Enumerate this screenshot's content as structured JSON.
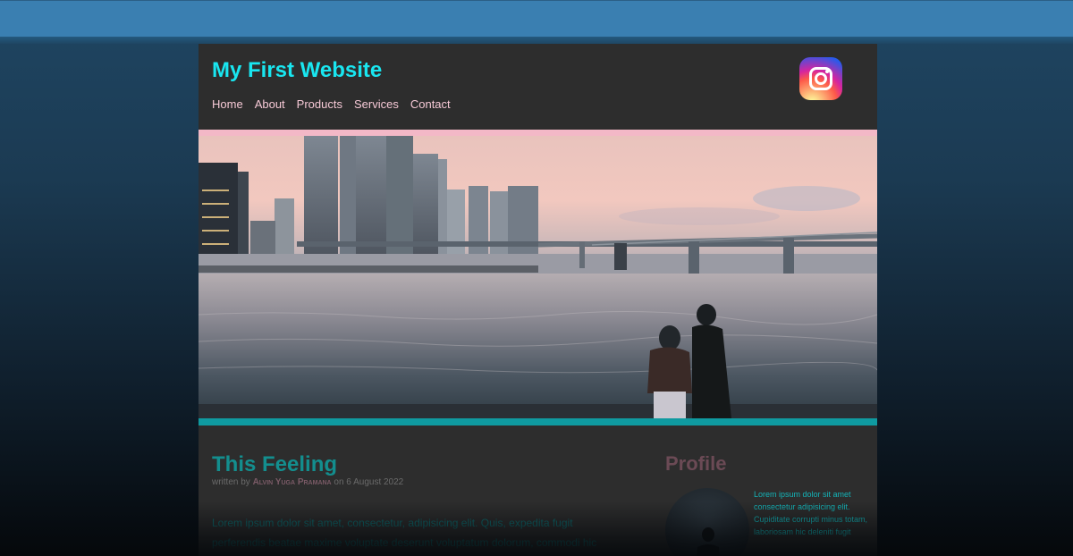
{
  "header": {
    "site_title": "My First Website",
    "nav": [
      "Home",
      "About",
      "Products",
      "Services",
      "Contact"
    ],
    "social_icon": "instagram-icon"
  },
  "hero": {
    "image": "city-skyline-beach-sunset-couple"
  },
  "post": {
    "title": "This Feeling",
    "byline_prefix": "written by",
    "author": "Alvin Yuga Pramana",
    "byline_on": "on",
    "date": "6 August 2022",
    "body": "Lorem ipsum dolor sit amet, consectetur, adipisicing elit. Quis, expedita fugit perferendis beatae maxime voluptate deserunt voluptatum dolorum, commodi hic"
  },
  "profile": {
    "title": "Profile",
    "text": "Lorem ipsum dolor sit amet consectetur adipisicing elit. Cupiditate corrupti minus totam, laboriosam hic deleniti fugit"
  },
  "colors": {
    "topbar": "#3a7fb1",
    "title": "#19e6f0",
    "nav": "#f6c9d6",
    "pink_strip": "#f3b8c7",
    "teal_strip": "#0f9aa0",
    "post_title": "#138e8e",
    "profile_title": "#6b4a55"
  }
}
